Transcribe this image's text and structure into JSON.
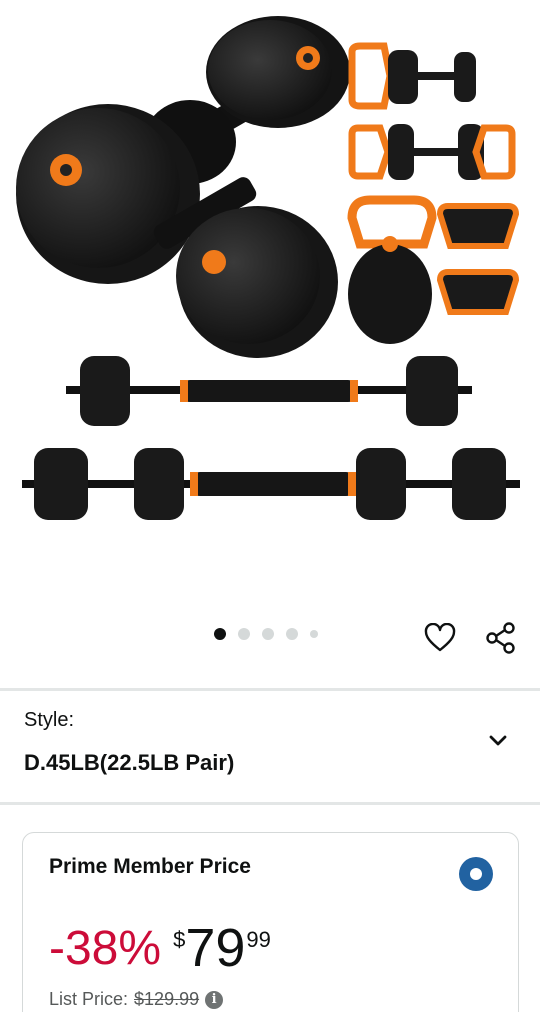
{
  "gallery": {
    "image_alt": "FEIERDUN adjustable dumbbell set",
    "dots": [
      {
        "active": true
      },
      {
        "active": false
      },
      {
        "active": false
      },
      {
        "active": false
      },
      {
        "active": false,
        "small": true
      }
    ]
  },
  "actions": {
    "favorite_icon": "heart-icon",
    "share_icon": "share-icon"
  },
  "style": {
    "label": "Style:",
    "value": "D.45LB(22.5LB Pair)",
    "chevron_icon": "chevron-down-icon"
  },
  "price_card": {
    "title": "Prime Member Price",
    "selected": true,
    "discount": "-38%",
    "currency_symbol": "$",
    "price_whole": "79",
    "price_fraction": "99",
    "list_price_label": "List Price:",
    "list_price_value": "$129.99",
    "info_icon": "info-icon"
  },
  "colors": {
    "discount_red": "#cc0c39",
    "radio_blue": "#2162a1",
    "accent_orange": "#f07a1a",
    "dumbbell_black": "#1a1a1a"
  }
}
